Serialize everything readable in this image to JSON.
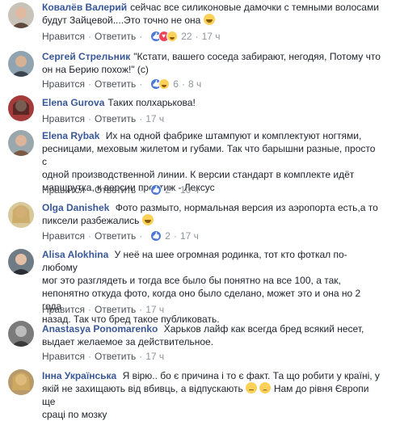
{
  "comments": [
    {
      "author": "Ковалёв Валерий",
      "lines": [
        "сейчас все силиконовые дамочки с темными волосами",
        "будут Зайцевой....Это точно не она"
      ],
      "like": "Нравится",
      "reply": "Ответить",
      "reactions_count": "22",
      "time": "17 ч"
    },
    {
      "author": "Сергей Стрельник",
      "lines": [
        "\"Кстати, вашего соседа забирают, негодяя, Потому что",
        "он на Берию похож!\" (с)"
      ],
      "like": "Нравится",
      "reply": "Ответить",
      "reactions_count": "6",
      "time": "8 ч"
    },
    {
      "author": "Elena Gurova",
      "lines": [
        "Таких полхарькова!"
      ],
      "like": "Нравится",
      "reply": "Ответить",
      "reactions_count": "",
      "time": "17 ч"
    },
    {
      "author": "Elena Rybak",
      "lines": [
        "Их на одной фабрике штампуют и комплектуют ногтями,",
        "ресницами, меховым жилетом и губами. Так что барышни разные, просто с",
        "одной производственной линии. К версии стандарт в комплекте идёт",
        "маршрутка, к версии престиж - Лексус"
      ],
      "like": "Нравится",
      "reply": "Ответить",
      "reactions_count": "2",
      "time": "10 ч"
    },
    {
      "author": "Olga Danishek",
      "lines": [
        "Фото размыто, нормальная версия из аэропорта есть,а то",
        "пиксели разбежались"
      ],
      "like": "Нравится",
      "reply": "Ответить",
      "reactions_count": "2",
      "time": "17 ч"
    },
    {
      "author": "Alisa Alokhina",
      "lines": [
        "У неё на шее огромная родинка, тот кто фоткал по-любому",
        "мог это разглядеть и тогда все было бы понятно на все 100, а так,",
        "непонятно откуда фото, когда оно было сделано, может это и она но 2 года",
        "назад. Так что бред такое публиковать."
      ],
      "like": "Нравится",
      "reply": "Ответить",
      "reactions_count": "",
      "time": "17 ч"
    },
    {
      "author": "Anastasya Ponomarenko",
      "lines": [
        "Харьков лайф как всегда бред всякий несет,",
        "выдает желаемое за действительное."
      ],
      "like": "Нравится",
      "reply": "Ответить",
      "reactions_count": "",
      "time": "17 ч"
    },
    {
      "author": "Інна Українська",
      "lines": [
        "Я вірю.. бо є причина і то є факт. Та що робити у країні, у",
        "якій не захищають від вбивць, а відпускають",
        "Нам до рівня Європи ще",
        "сраці по мозку"
      ],
      "like": "",
      "reply": "",
      "reactions_count": "",
      "time": ""
    }
  ],
  "separator": "·",
  "colors": {
    "author": "#385898",
    "meta": "#90949c",
    "link": "#4b4f56",
    "like_blue": "#4a76d6",
    "love_red": "#f0425c"
  }
}
